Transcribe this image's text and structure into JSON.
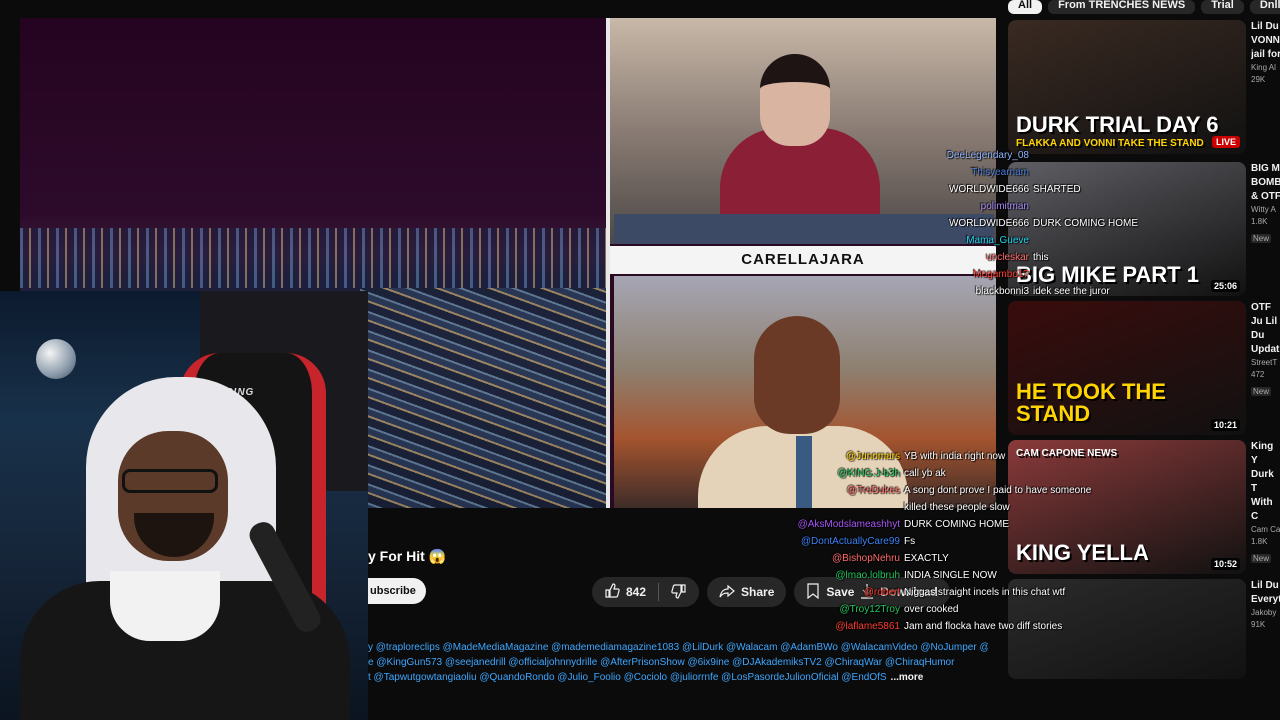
{
  "filter_chips": [
    "All",
    "From TRENCHES NEWS",
    "Trial",
    "Dnll mu"
  ],
  "video": {
    "nameplate": "CARELLAJARA",
    "title_visible": "y For Hit 😱",
    "subscribe_label": "ubscribe",
    "likes": "842",
    "share_label": "Share",
    "save_label": "Save",
    "download_label": "Download",
    "description_lines": [
      "y @traploreclips @MadeMediaMagazine @mademediamagazine1083 @LilDurk @Walacam @AdamBWo @WalacamVideo @NoJumper @DjAkademiks",
      "e @KingGun573 @seejanedrill @officialjohnnydrille @AfterPrisonShow @6ix9ine @DJAkademiksTV2 @ChiraqWar @ChiraqHumor",
      "t @Tapwutgowtangiaoliu @QuandoRondo @Julio_Foolio @Cociolo @juliorrnfe @LosPasordeJulionOficial @EndOfS"
    ],
    "more_label": "...more"
  },
  "webcam": {
    "chair_brand": "TRCING"
  },
  "recommendations": [
    {
      "thumb_text": "DURK TRIAL DAY 6",
      "thumb_sub": "FLAKKA AND VONNI TAKE THE STAND",
      "badge": "LIVE",
      "title": "Lil Du VONNI jail for",
      "channel": "King Al",
      "views": "29K",
      "tag": "",
      "thumb_color": "#3a2a22"
    },
    {
      "thumb_text": "BIG MIKE PART 1",
      "thumb_sub": "",
      "badge": "25:06",
      "title": "BIG M BOMBE & OTF",
      "channel": "Witty A",
      "views": "1.8K",
      "tag": "New",
      "thumb_color": "#5e5e64"
    },
    {
      "thumb_text": "HE TOOK THE STAND",
      "thumb_sub": "",
      "badge": "10:21",
      "title": "OTF Ju Lil Du Updat",
      "channel": "StreetT",
      "views": "472",
      "tag": "New",
      "thumb_color": "#3a0c0c"
    },
    {
      "thumb_text": "KING YELLA",
      "thumb_sub": "CAM CAPONE NEWS",
      "badge": "10:52",
      "title": "King Y Durk T With C",
      "channel": "Cam Ca",
      "views": "1.8K",
      "tag": "New",
      "thumb_color": "#8a3a3a"
    },
    {
      "thumb_text": "",
      "thumb_sub": "",
      "badge": "",
      "title": "Lil Du Everyt",
      "channel": "Jakoby",
      "views": "91K",
      "tag": "",
      "thumb_color": "#2b2b2b"
    }
  ],
  "chat_upper": [
    {
      "user": "DeeLegendary_08",
      "msg": "",
      "color": "#8fb4ff"
    },
    {
      "user": "Thisyearnam",
      "msg": "",
      "color": "#4a7fd8"
    },
    {
      "user": "WORLDWIDE666",
      "msg": "SHARTED",
      "color": "#ffffff"
    },
    {
      "user": "polimitman",
      "msg": "",
      "color": "#a78bfa"
    },
    {
      "user": "WORLDWIDE666",
      "msg": "DURK COMING HOME",
      "color": "#ffffff"
    },
    {
      "user": "Mama_Gueve",
      "msg": "",
      "color": "#22d3ee"
    },
    {
      "user": "uncleskar",
      "msg": "this",
      "color": "#ff6b6b"
    },
    {
      "user": "Mogambo17",
      "msg": "",
      "color": "#ff3b30"
    },
    {
      "user": "blackbonni3",
      "msg": "idek see the juror",
      "color": "#ffffff"
    }
  ],
  "chat_lower": [
    {
      "user": "@Junomars",
      "msg": "YB with india right now",
      "color": "#ffcc00"
    },
    {
      "user": "@KING.J-b3h",
      "msg": "call yb ak",
      "color": "#22c55e"
    },
    {
      "user": "@TreDukes",
      "msg": "A song dont prove I paid to have someone",
      "color": "#ff6b6b"
    },
    {
      "user": "",
      "msg": "killed these people slow",
      "color": "#ffffff"
    },
    {
      "user": "@AksModslameashhyt",
      "msg": "DURK COMING HOME",
      "color": "#a855f7"
    },
    {
      "user": "@DontActuallyCare99",
      "msg": "Fs",
      "color": "#3b82f6"
    },
    {
      "user": "@BishopNehru",
      "msg": "EXACTLY",
      "color": "#ff6b6b"
    },
    {
      "user": "@lmao.lolbruh",
      "msg": "INDIA SINGLE NOW",
      "color": "#22c55e"
    },
    {
      "user": "@robert",
      "msg": "Niggas straight incels in this chat wtf",
      "color": "#ff3b30"
    },
    {
      "user": "@Troy12Troy",
      "msg": "over cooked",
      "color": "#22c55e"
    },
    {
      "user": "@laflame5861",
      "msg": "Jam and flocka have two diff stories",
      "color": "#ff3b30"
    }
  ]
}
